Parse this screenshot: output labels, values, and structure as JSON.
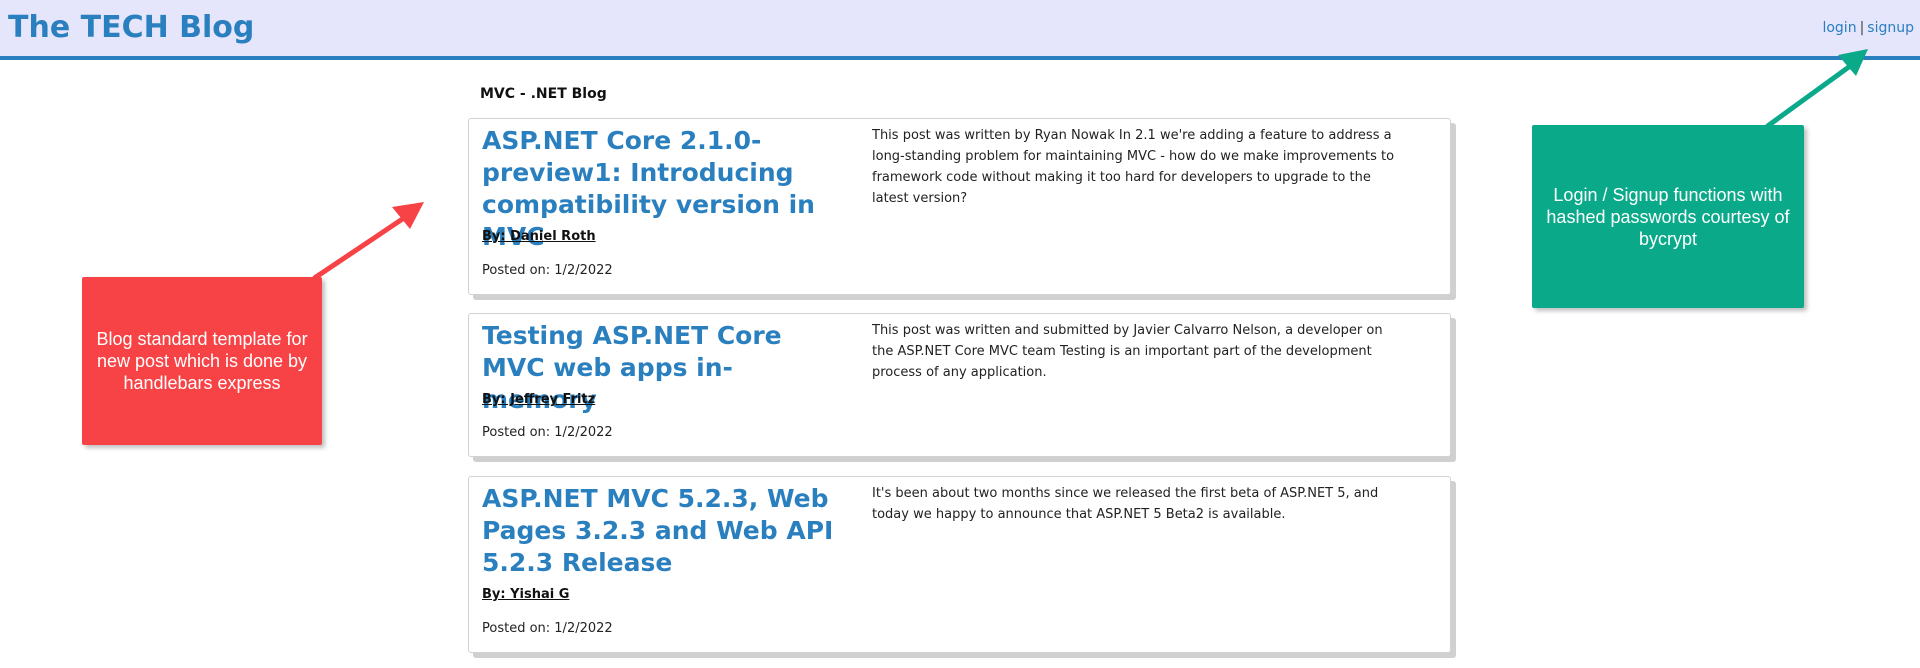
{
  "header": {
    "brand": "The TECH Blog",
    "login_label": "login",
    "separator": "|",
    "signup_label": "signup"
  },
  "section": {
    "title": "MVC - .NET Blog"
  },
  "posts": [
    {
      "title": "ASP.NET Core 2.1.0-preview1: Introducing compatibility version in MVC",
      "author": "By: Daniel Roth",
      "date": "Posted on: 1/2/2022",
      "excerpt": "This post was written by Ryan Nowak In 2.1 we're adding a feature to address a long-standing problem for maintaining MVC - how do we make improvements to framework code without making it too hard for developers to upgrade to the latest version?"
    },
    {
      "title": "Testing ASP.NET Core MVC web apps in-memory",
      "author": "By: Jeffrey Fritz",
      "date": "Posted on: 1/2/2022",
      "excerpt": "This post was written and submitted by Javier Calvarro Nelson, a developer on the ASP.NET Core MVC team Testing is an important part of the development process of any application."
    },
    {
      "title": "ASP.NET MVC 5.2.3, Web Pages 3.2.3 and Web API 5.2.3 Release",
      "author": "By: Yishai G",
      "date": "Posted on: 1/2/2022",
      "excerpt": "It's been about two months since we released the first beta of ASP.NET 5, and today we happy to announce that ASP.NET 5 Beta2 is available."
    }
  ],
  "annotations": {
    "template_note": "Blog standard template for new post which is done by handlebars express",
    "auth_note": "Login / Signup functions with hashed passwords courtesy of bycrypt"
  },
  "colors": {
    "accent": "#2a7fbf",
    "header_bg": "#e5e5fb",
    "callout_red": "#f74346",
    "callout_green": "#09a98a"
  }
}
